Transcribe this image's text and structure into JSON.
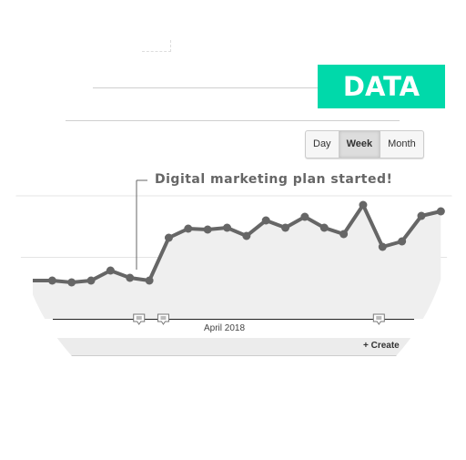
{
  "badge": {
    "label": "DATA",
    "color": "#00d9aa"
  },
  "toggle": {
    "options": [
      "Day",
      "Week",
      "Month"
    ],
    "selected": "Week"
  },
  "annotation": {
    "text": "Digital marketing plan started!"
  },
  "axis": {
    "month_label": "April 2018"
  },
  "footer": {
    "create_label": "+ Create"
  },
  "chart_data": {
    "type": "area",
    "title": "",
    "x_label": "April 2018",
    "values": [
      42,
      42,
      40,
      42,
      53,
      45,
      42,
      89,
      99,
      98,
      100,
      91,
      108,
      100,
      112,
      100,
      93,
      125,
      79,
      85,
      113,
      118
    ],
    "ylim": [
      0,
      135
    ],
    "grid": true,
    "line_color": "#666666",
    "fill_color": "#efefef",
    "annotation_markers": [
      5,
      7,
      18
    ]
  }
}
